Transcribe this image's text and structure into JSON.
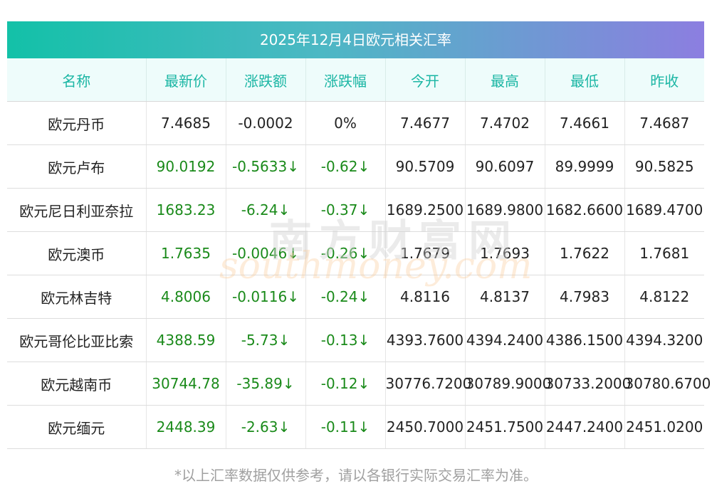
{
  "title": "2025年12月4日欧元相关汇率",
  "headers": [
    "名称",
    "最新价",
    "涨跌额",
    "涨跌幅",
    "今开",
    "最高",
    "最低",
    "昨收"
  ],
  "rows": [
    {
      "name": "欧元丹币",
      "latest": "7.4685",
      "change": "-0.0002",
      "pct": "0%",
      "open": "7.4677",
      "high": "7.4702",
      "low": "7.4661",
      "prev": "7.4687",
      "colored": false
    },
    {
      "name": "欧元卢布",
      "latest": "90.0192",
      "change": "-0.5633↓",
      "pct": "-0.62↓",
      "open": "90.5709",
      "high": "90.6097",
      "low": "89.9999",
      "prev": "90.5825",
      "colored": true
    },
    {
      "name": "欧元尼日利亚奈拉",
      "latest": "1683.23",
      "change": "-6.24↓",
      "pct": "-0.37↓",
      "open": "1689.2500",
      "high": "1689.9800",
      "low": "1682.6600",
      "prev": "1689.4700",
      "colored": true
    },
    {
      "name": "欧元澳币",
      "latest": "1.7635",
      "change": "-0.0046↓",
      "pct": "-0.26↓",
      "open": "1.7679",
      "high": "1.7693",
      "low": "1.7622",
      "prev": "1.7681",
      "colored": true
    },
    {
      "name": "欧元林吉特",
      "latest": "4.8006",
      "change": "-0.0116↓",
      "pct": "-0.24↓",
      "open": "4.8116",
      "high": "4.8137",
      "low": "4.7983",
      "prev": "4.8122",
      "colored": true
    },
    {
      "name": "欧元哥伦比亚比索",
      "latest": "4388.59",
      "change": "-5.73↓",
      "pct": "-0.13↓",
      "open": "4393.7600",
      "high": "4394.2400",
      "low": "4386.1500",
      "prev": "4394.3200",
      "colored": true
    },
    {
      "name": "欧元越南币",
      "latest": "30744.78",
      "change": "-35.89↓",
      "pct": "-0.12↓",
      "open": "30776.7200",
      "high": "30789.9000",
      "low": "30733.2000",
      "prev": "30780.6700",
      "colored": true
    },
    {
      "name": "欧元缅元",
      "latest": "2448.39",
      "change": "-2.63↓",
      "pct": "-0.11↓",
      "open": "2450.7000",
      "high": "2451.7500",
      "low": "2447.2400",
      "prev": "2451.0200",
      "colored": true
    }
  ],
  "footnote": "*以上汇率数据仅供参考，请以各银行实际交易汇率为准。",
  "watermark": {
    "cn": "南方财富网",
    "en": "southmoney.com"
  },
  "colors": {
    "header_text": "#1bb6a4",
    "change_text": "#1a8a1a",
    "title_gradient_start": "#13c1a8",
    "title_gradient_end": "#8c7ee0"
  }
}
